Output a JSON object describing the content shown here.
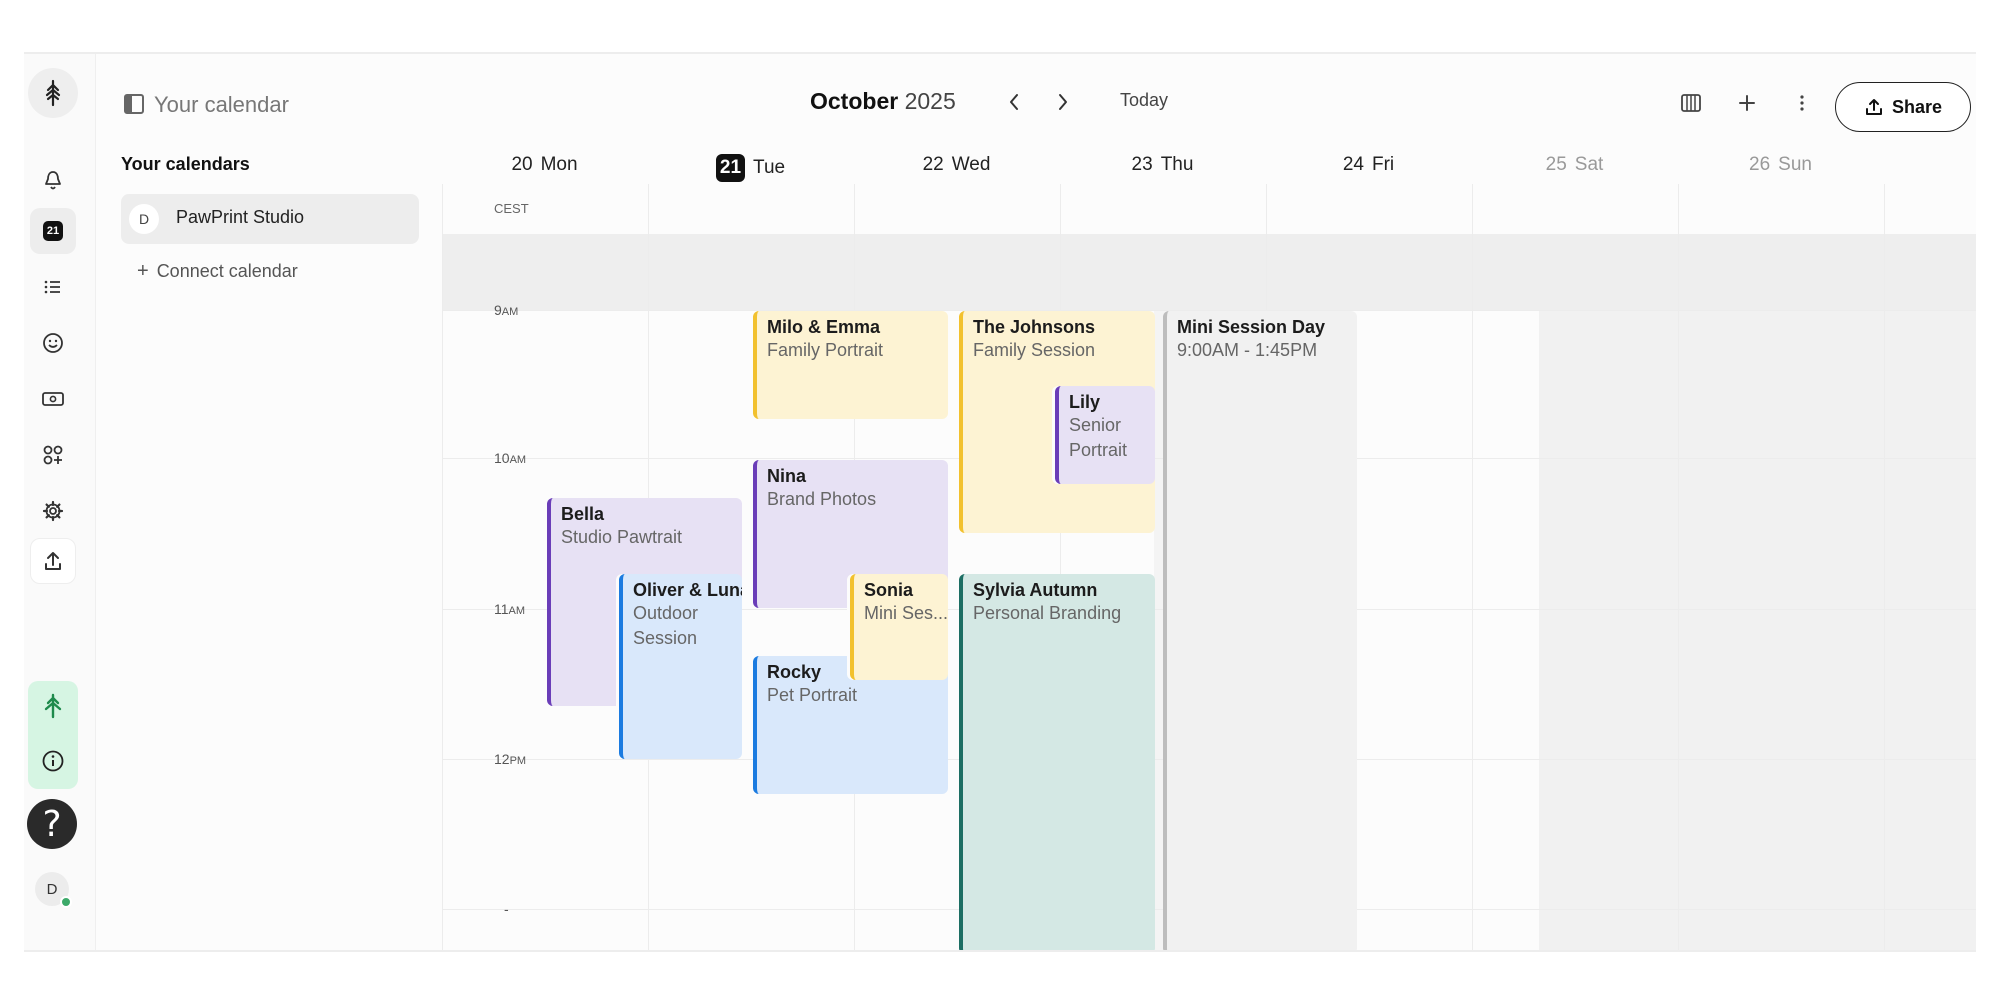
{
  "sidebar": {
    "title": "Your calendar",
    "calendars_heading": "Your calendars",
    "calendar_item": {
      "initial": "D",
      "name": "PawPrint Studio"
    },
    "connect_label": "Connect calendar"
  },
  "rail": {
    "calendar_day": "21",
    "avatar_initial": "D",
    "help_glyph": "?"
  },
  "header": {
    "month": "October",
    "year": "2025",
    "today_label": "Today",
    "share_label": "Share"
  },
  "timezone": "CEST",
  "days": [
    {
      "num": "20",
      "name": "Mon",
      "today": false,
      "weekend": false
    },
    {
      "num": "21",
      "name": "Tue",
      "today": true,
      "weekend": false
    },
    {
      "num": "22",
      "name": "Wed",
      "today": false,
      "weekend": false
    },
    {
      "num": "23",
      "name": "Thu",
      "today": false,
      "weekend": false
    },
    {
      "num": "24",
      "name": "Fri",
      "today": false,
      "weekend": false
    },
    {
      "num": "25",
      "name": "Sat",
      "today": false,
      "weekend": true
    },
    {
      "num": "26",
      "name": "Sun",
      "today": false,
      "weekend": true
    }
  ],
  "hours": [
    {
      "num": "9",
      "suffix": "AM"
    },
    {
      "num": "10",
      "suffix": "AM"
    },
    {
      "num": "11",
      "suffix": "AM"
    },
    {
      "num": "12",
      "suffix": "PM"
    },
    {
      "num": "-",
      "suffix": ""
    }
  ],
  "events": [
    {
      "title": "Milo & Emma",
      "lines": [
        "Family Portrait"
      ]
    },
    {
      "title": "Nina",
      "lines": [
        "Brand Photos"
      ]
    },
    {
      "title": "Sonia",
      "lines": [
        "Mini Ses..."
      ]
    },
    {
      "title": "Rocky",
      "lines": [
        "Pet Portrait"
      ]
    },
    {
      "title": "Bella",
      "lines": [
        "Studio Pawtrait"
      ]
    },
    {
      "title": "Oliver & Luna",
      "lines": [
        "Outdoor",
        "Session"
      ]
    },
    {
      "title": "The Johnsons",
      "lines": [
        "Family Session"
      ]
    },
    {
      "title": "Lily",
      "lines": [
        "Senior",
        "Portrait"
      ]
    },
    {
      "title": "Sylvia Autumn",
      "lines": [
        "Personal Branding"
      ]
    },
    {
      "title": "Mini Session Day",
      "lines": [
        "9:00AM - 1:45PM"
      ]
    }
  ],
  "colors": {
    "yellow_bg": "#fdf3d3",
    "yellow_bar": "#f2c12e",
    "purple_bg": "#e7e1f4",
    "purple_bar": "#6a3db8",
    "blue_bg": "#d9e8fb",
    "blue_bar": "#1b7be0",
    "teal_bg": "#d4e8e4",
    "teal_bar": "#1c6e63",
    "gray_bg": "#f1f1f1",
    "gray_bar": "#bdbdbd"
  }
}
